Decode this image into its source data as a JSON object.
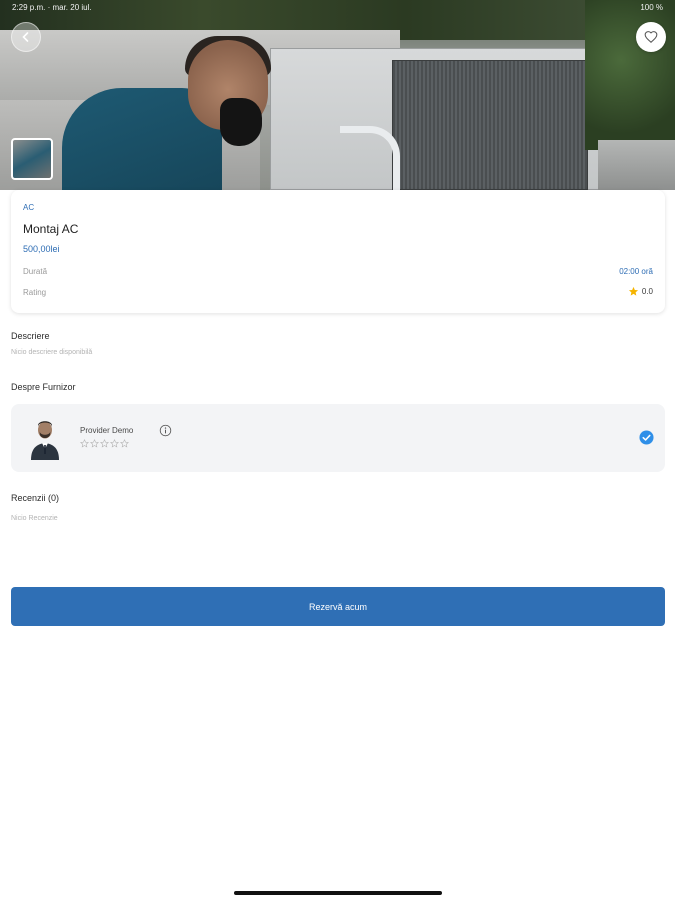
{
  "status_bar": {
    "time": "2:29 p.m. · mar. 20 iul.",
    "right": "100 %"
  },
  "icons": {
    "back": "chevron-left-icon",
    "favorite": "heart-icon",
    "rating_star": "star-icon",
    "info": "info-icon",
    "verified": "check-circle-icon"
  },
  "service": {
    "category": "AC",
    "title": "Montaj AC",
    "price": "500,00lei",
    "duration_label": "Durată",
    "duration_value": "02:00 oră",
    "rating_label": "Rating",
    "rating_value": "0.0"
  },
  "description": {
    "title": "Descriere",
    "text": "Nicio descriere disponibilă"
  },
  "provider_section": {
    "title": "Despre Furnizor",
    "name": "Provider Demo",
    "stars": 0,
    "max_stars": 5
  },
  "reviews": {
    "title": "Recenzii (0)",
    "empty_text": "Nicio Recenzie"
  },
  "cta": {
    "label": "Rezervă acum"
  },
  "colors": {
    "accent": "#2f6fb5",
    "star": "#f5b400",
    "verified": "#2f8fe8"
  }
}
